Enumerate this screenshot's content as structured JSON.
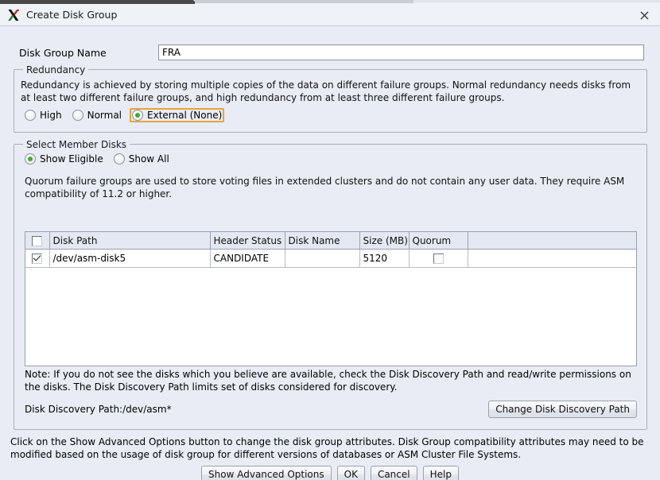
{
  "window": {
    "title": "Create Disk Group",
    "app_icon": "x-org-logo-icon",
    "close_label": "×"
  },
  "form": {
    "disk_group_name_label": "Disk Group Name",
    "disk_group_name_value": "FRA",
    "disk_group_name_placeholder": ""
  },
  "redundancy": {
    "title": "Redundancy",
    "description": "Redundancy is achieved by storing multiple copies of the data on different failure groups. Normal redundancy needs disks from at least two different failure groups, and high redundancy from at least three different failure groups.",
    "options": [
      {
        "label": "High",
        "selected": false,
        "focused": false
      },
      {
        "label": "Normal",
        "selected": false,
        "focused": false
      },
      {
        "label": "External (None)",
        "selected": true,
        "focused": true
      }
    ]
  },
  "member_disks": {
    "title": "Select Member Disks",
    "filter_options": [
      {
        "label": "Show Eligible",
        "selected": true,
        "focused": false
      },
      {
        "label": "Show All",
        "selected": false,
        "focused": false
      }
    ],
    "quorum_description": "Quorum failure groups are used to store voting files in extended clusters and do not contain any user data. They require ASM compatibility of 11.2 or higher.",
    "table": {
      "columns": [
        "",
        "Disk Path",
        "Header Status",
        "Disk Name",
        "Size (MB)",
        "Quorum",
        ""
      ],
      "rows": [
        {
          "selected": true,
          "disk_path": "/dev/asm-disk5",
          "header_status": "CANDIDATE",
          "disk_name": "",
          "size_mb": "5120",
          "quorum": false
        }
      ]
    },
    "note": "Note: If you do not see the disks which you believe are available, check the Disk Discovery Path and read/write permissions on the disks. The Disk Discovery Path limits set of disks considered for discovery.",
    "discovery_path_label": "Disk Discovery Path:/dev/asm*",
    "change_discovery_button": "Change Disk Discovery Path"
  },
  "footer": {
    "advanced_note": "Click on the Show Advanced Options button to change the disk group attributes. Disk Group compatibility attributes may need to be modified based on the usage of disk group for different versions of databases or ASM Cluster File Systems.",
    "buttons": [
      {
        "label": "Show Advanced Options",
        "name": "show-advanced-options-button"
      },
      {
        "label": "OK",
        "name": "ok-button"
      },
      {
        "label": "Cancel",
        "name": "cancel-button"
      },
      {
        "label": "Help",
        "name": "help-button"
      }
    ]
  },
  "colors": {
    "dialog_background": "#e9ecf4",
    "titlebar_background": "#eff2f7",
    "panel_border": "#a9aebb",
    "radio_selected": "#3faa34",
    "focus_ring": "#e8a33d",
    "table_header": "#e4e8f2",
    "table_body": "#ffffff"
  }
}
